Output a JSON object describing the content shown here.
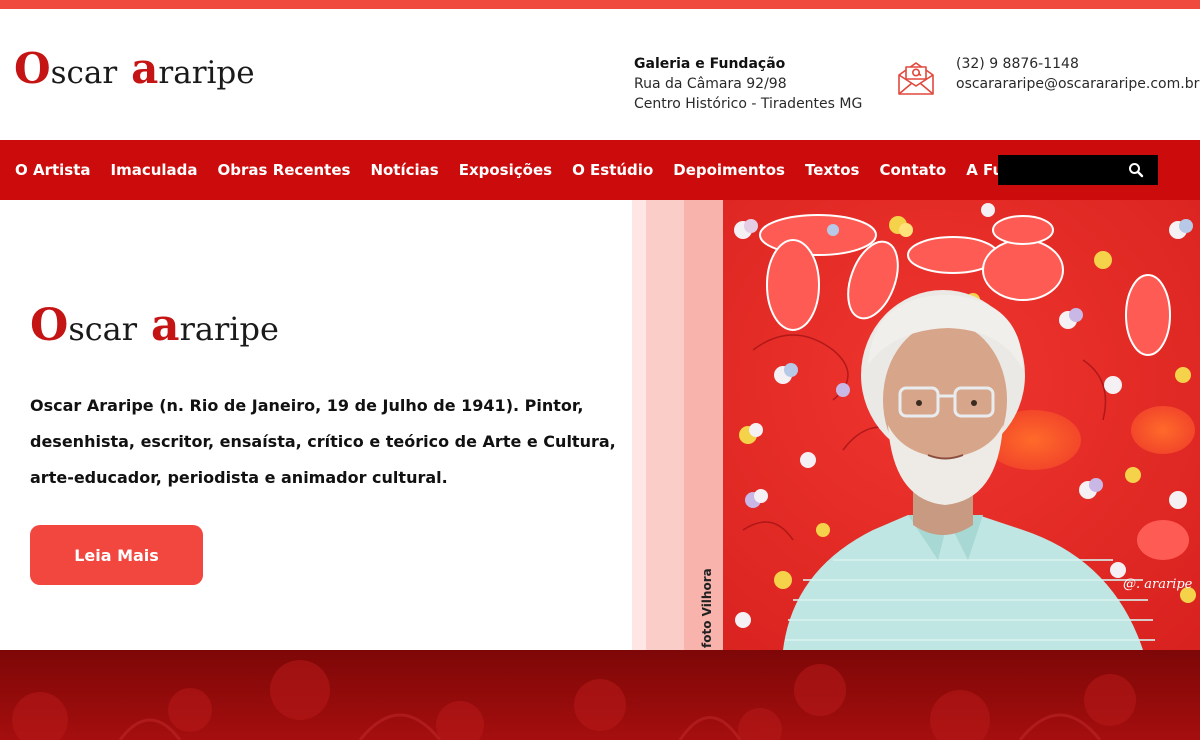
{
  "colors": {
    "accent": "#f04a3f",
    "nav_bg": "#cc0c0c",
    "logo_red": "#c51414",
    "button": "#f1473f",
    "dark_red": "#8c0a0a"
  },
  "header": {
    "logo": {
      "initial_1": "O",
      "rest_1": "scar",
      "initial_2": "a",
      "rest_2": "raripe"
    },
    "address": {
      "title": "Galeria e Fundação",
      "line1": "Rua da Câmara 92/98",
      "line2": "Centro Histórico - Tiradentes MG"
    },
    "contact": {
      "icon": "mail-icon",
      "phone": "(32) 9 8876-1148",
      "email": "oscarararipe@oscarararipe.com.br"
    }
  },
  "nav": {
    "items": [
      {
        "label": "O Artista"
      },
      {
        "label": "Imaculada"
      },
      {
        "label": "Obras Recentes"
      },
      {
        "label": "Notícias"
      },
      {
        "label": "Exposições"
      },
      {
        "label": "O Estúdio"
      },
      {
        "label": "Depoimentos"
      },
      {
        "label": "Textos"
      },
      {
        "label": "Contato"
      },
      {
        "label": "A Fundação"
      }
    ],
    "search": {
      "placeholder": "",
      "icon": "search-icon"
    }
  },
  "hero": {
    "logo": {
      "initial_1": "O",
      "rest_1": "scar",
      "initial_2": "a",
      "rest_2": "raripe"
    },
    "bio": "Oscar Araripe (n. Rio de Janeiro, 19 de Julho de 1941). Pintor, desenhista, escritor, ensaísta, crítico e teórico de Arte e Cultura, arte-educador, periodista e animador cultural.",
    "button_label": "Leia Mais",
    "photo_credit": "foto Vilhora",
    "painting_signature": "@. araripe"
  }
}
